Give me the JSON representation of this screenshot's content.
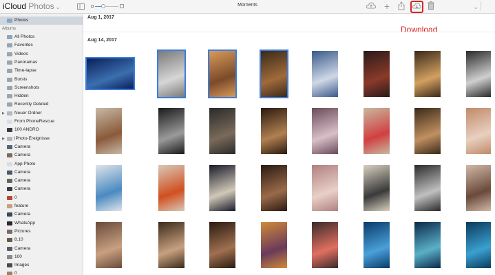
{
  "app": {
    "name_main": "iCloud",
    "name_sub": "Photos"
  },
  "toolbar": {
    "title": "Moments",
    "icons": [
      "sidebar-toggle-icon",
      "upload-icon",
      "add-icon",
      "share-icon",
      "download-icon",
      "trash-icon",
      "chevron-down-icon"
    ]
  },
  "annotation": {
    "label": "Download",
    "color": "#dd2222"
  },
  "sidebar": {
    "top_item": "Photos",
    "section_header": "Albums",
    "items": [
      {
        "label": "All Photos",
        "icon": "#8aa6c1"
      },
      {
        "label": "Favorites",
        "icon": "#9aa4ae"
      },
      {
        "label": "Videos",
        "icon": "#9aa4ae"
      },
      {
        "label": "Panoramas",
        "icon": "#9aa4ae"
      },
      {
        "label": "Time-lapse",
        "icon": "#9aa4ae"
      },
      {
        "label": "Bursts",
        "icon": "#9aa4ae"
      },
      {
        "label": "Screenshots",
        "icon": "#9aa4ae"
      },
      {
        "label": "Hidden",
        "icon": "#9aa4ae"
      },
      {
        "label": "Recently Deleted",
        "icon": "#9aa4ae"
      },
      {
        "label": "Neuer Ordner",
        "icon": "#b0b8c0"
      },
      {
        "label": "From PhoneRescue",
        "icon": "#d7dde3"
      },
      {
        "label": "100 ANDRO",
        "icon": "#3a3a3a"
      },
      {
        "label": "iPhoto-Ereignisse",
        "icon": "#b0b8c0"
      },
      {
        "label": "Camera",
        "icon": "#556677"
      },
      {
        "label": "Camera",
        "icon": "#7a6a5a"
      },
      {
        "label": "App Photo",
        "icon": "#d7dde3"
      },
      {
        "label": "Camera",
        "icon": "#4a5a6a"
      },
      {
        "label": "Camera",
        "icon": "#5a6a5a"
      },
      {
        "label": "Camera",
        "icon": "#3a3a4a"
      },
      {
        "label": "0",
        "icon": "#b04a3a"
      },
      {
        "label": "feature",
        "icon": "#c8a080"
      },
      {
        "label": "Camera",
        "icon": "#3a4a5a"
      },
      {
        "label": "WhatsApp",
        "icon": "#2a2a2a"
      },
      {
        "label": "Pictures",
        "icon": "#7a6a6a"
      },
      {
        "label": "8.10",
        "icon": "#6a5a4a"
      },
      {
        "label": "Camera",
        "icon": "#5a5a6a"
      },
      {
        "label": "100",
        "icon": "#8a8a8a"
      },
      {
        "label": "Images",
        "icon": "#4a4a4a"
      },
      {
        "label": "0",
        "icon": "#a08060"
      }
    ]
  },
  "moments": [
    {
      "date": "Aug 1, 2017"
    },
    {
      "date": "Aug 14, 2017"
    }
  ],
  "photos": [
    {
      "c1": "#0a1f5a",
      "c2": "#3b6fb0",
      "selected": true
    },
    {
      "c1": "#7a7a7a",
      "c2": "#d6d6d6",
      "selected": true
    },
    {
      "c1": "#d99a5a",
      "c2": "#7a4a2a",
      "selected": true
    },
    {
      "c1": "#3a2a1a",
      "c2": "#a06a3a",
      "selected": true
    },
    {
      "c1": "#3a5a8a",
      "c2": "#cfd8e6",
      "selected": false
    },
    {
      "c1": "#2a1a1a",
      "c2": "#8a3a2a",
      "selected": false
    },
    {
      "c1": "#3a2a1a",
      "c2": "#d2a060",
      "selected": false
    },
    {
      "c1": "#2a2a2a",
      "c2": "#cfcfcf",
      "selected": false
    },
    {
      "c1": "#c7b8a6",
      "c2": "#8a5a3a",
      "selected": false
    },
    {
      "c1": "#1a1a1a",
      "c2": "#9a9a9a",
      "selected": false
    },
    {
      "c1": "#2a2a2a",
      "c2": "#7a6a5a",
      "selected": false
    },
    {
      "c1": "#2a1a10",
      "c2": "#b08050",
      "selected": false
    },
    {
      "c1": "#6a4a5a",
      "c2": "#d8c0c8",
      "selected": false
    },
    {
      "c1": "#c8b8a0",
      "c2": "#d04040",
      "selected": false
    },
    {
      "c1": "#3a2a1a",
      "c2": "#c09060",
      "selected": false
    },
    {
      "c1": "#c08a6a",
      "c2": "#e8d0c0",
      "selected": false
    },
    {
      "c1": "#dfe4ea",
      "c2": "#4a8ac0",
      "selected": false
    },
    {
      "c1": "#d8c8b8",
      "c2": "#d05020",
      "selected": false
    },
    {
      "c1": "#1a1a2a",
      "c2": "#d0c8b8",
      "selected": false
    },
    {
      "c1": "#2a1a10",
      "c2": "#9a6a4a",
      "selected": false
    },
    {
      "c1": "#b08080",
      "c2": "#e8d0c8",
      "selected": false
    },
    {
      "c1": "#d8d0c0",
      "c2": "#3a3a3a",
      "selected": false
    },
    {
      "c1": "#2a2a2a",
      "c2": "#c0c0c0",
      "selected": false
    },
    {
      "c1": "#d0b8a8",
      "c2": "#6a4a3a",
      "selected": false
    },
    {
      "c1": "#6a4a3a",
      "c2": "#c8a080",
      "selected": false
    },
    {
      "c1": "#3a2a1a",
      "c2": "#c8a080",
      "selected": false
    },
    {
      "c1": "#2a1a10",
      "c2": "#a07050",
      "selected": false
    },
    {
      "c1": "#d08a3a",
      "c2": "#6a3a5a",
      "selected": false
    },
    {
      "c1": "#3a2a2a",
      "c2": "#e07060",
      "selected": false
    },
    {
      "c1": "#0a3a6a",
      "c2": "#4aa0d8",
      "selected": false
    },
    {
      "c1": "#0a2a4a",
      "c2": "#5ab0c8",
      "selected": false
    },
    {
      "c1": "#0a3a5a",
      "c2": "#3aa0d0",
      "selected": false
    }
  ]
}
